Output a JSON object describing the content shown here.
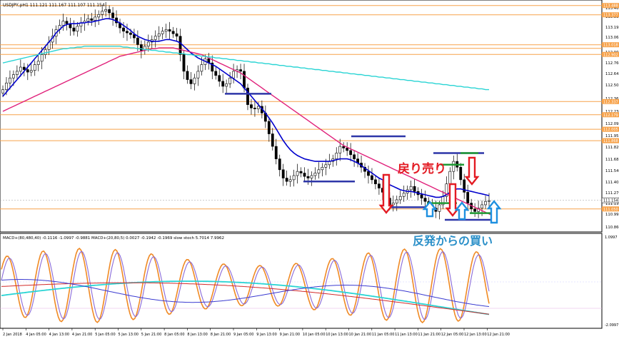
{
  "window": {
    "symbol_line": "USDJPY,pH1  111.121 111.167 111.107 111.154"
  },
  "macd_panel": {
    "info_line": "MACD+(80,480,40) -0.1116 -1.0997 -0.9881  MACD+(20,80,5) 0.0027 -0.1942 -0.1969  slow stoch 5.7014 7.9962",
    "axis_top": "1.0997",
    "axis_bottom": "-2.0997"
  },
  "annotations": {
    "sell_text": "戻り売り",
    "buy_text": "反発からの買い"
  },
  "colors": {
    "ma_fast": "#0000cc",
    "ma_mid": "#e0207a",
    "ma_slow": "#29d4d4",
    "level_line": "#f7a24a",
    "support_line": "#2d36a8",
    "green_line": "#1f9a33",
    "sell_arrow": "#e31b23",
    "buy_arrow": "#1e90e0",
    "sell_text": "#e31b23",
    "buy_text": "#2a8fc8",
    "current_price_tag": "#ffffff"
  },
  "chart_data": [
    {
      "type": "candlestick",
      "title": "USDJPY,pH1",
      "y_ticks": [
        "113.465",
        "113.335",
        "113.195",
        "113.065",
        "112.905",
        "112.760",
        "112.645",
        "112.505",
        "112.365",
        "112.230",
        "112.095",
        "111.955",
        "111.820",
        "111.685",
        "111.540",
        "111.405",
        "111.270",
        "111.135",
        "110.995",
        "110.860"
      ],
      "x_ticks": [
        "2 Jan 2018",
        "4 Jan 05:00",
        "4 Jan 13:00",
        "4 Jan 21:00",
        "5 Jan 05:00",
        "5 Jan 13:00",
        "5 Jan 21:00",
        "8 Jan 05:00",
        "8 Jan 13:00",
        "8 Jan 21:00",
        "9 Jan 05:00",
        "9 Jan 13:00",
        "9 Jan 21:00",
        "10 Jan 05:00",
        "10 Jan 13:00",
        "10 Jan 21:00",
        "11 Jan 05:00",
        "11 Jan 13:00",
        "11 Jan 21:00",
        "12 Jan 05:00",
        "12 Jan 13:00",
        "12 Jan 21:00"
      ],
      "ylim": [
        110.8,
        113.52
      ],
      "price_tags": {
        "current": "111.154",
        "bottom_level": "111.050",
        "tag_1": "113.488",
        "tag_2": "113.377",
        "tag_3": "113.018",
        "tag_4": "112.902",
        "tag_5": "112.337",
        "tag_6": "112.179",
        "tag_7": "112.005",
        "tag_8": "111.868"
      },
      "level_values": [
        113.488,
        113.377,
        113.018,
        112.975,
        112.902,
        112.337,
        112.179,
        112.005,
        111.868,
        111.05
      ],
      "close": [
        112.48,
        112.56,
        112.62,
        112.66,
        112.7,
        112.75,
        112.72,
        112.69,
        112.71,
        112.78,
        112.82,
        112.9,
        112.96,
        113.05,
        113.12,
        113.2,
        113.25,
        113.3,
        113.27,
        113.22,
        113.18,
        113.24,
        113.28,
        113.3,
        113.33,
        113.31,
        113.35,
        113.38,
        113.42,
        113.44,
        113.4,
        113.34,
        113.28,
        113.22,
        113.18,
        113.16,
        113.14,
        113.1,
        113.02,
        112.95,
        113.0,
        113.05,
        113.08,
        113.12,
        113.15,
        113.18,
        113.2,
        113.18,
        113.15,
        113.12,
        112.9,
        112.7,
        112.6,
        112.55,
        112.62,
        112.7,
        112.78,
        112.85,
        112.8,
        112.7,
        112.65,
        112.58,
        112.52,
        112.55,
        112.62,
        112.7,
        112.72,
        112.7,
        112.5,
        112.3,
        112.26,
        112.25,
        112.28,
        112.2,
        112.1,
        111.95,
        111.8,
        111.65,
        111.52,
        111.42,
        111.38,
        111.4,
        111.45,
        111.5,
        111.48,
        111.44,
        111.42,
        111.45,
        111.48,
        111.52,
        111.55,
        111.58,
        111.62,
        111.65,
        111.72,
        111.8,
        111.78,
        111.75,
        111.7,
        111.65,
        111.6,
        111.55,
        111.5,
        111.45,
        111.4,
        111.35,
        111.3,
        111.25,
        111.18,
        111.1,
        111.12,
        111.16,
        111.2,
        111.24,
        111.28,
        111.32,
        111.26,
        111.22,
        111.18,
        111.14,
        111.1,
        111.06,
        111.02,
        111.1,
        111.2,
        111.35,
        111.5,
        111.62,
        111.55,
        111.4,
        111.25,
        111.12,
        111.05,
        111.02,
        111.06,
        111.1,
        111.14,
        111.15
      ],
      "series": [
        {
          "name": "",
          "role": "fast",
          "values": [
            112.4,
            112.45,
            112.5,
            112.55,
            112.6,
            112.65,
            112.7,
            112.75,
            112.8,
            112.85,
            112.9,
            112.95,
            113.0,
            113.05,
            113.1,
            113.16,
            113.2,
            113.24,
            113.26,
            113.27,
            113.27,
            113.27,
            113.28,
            113.28,
            113.29,
            113.29,
            113.3,
            113.31,
            113.32,
            113.33,
            113.33,
            113.32,
            113.3,
            113.28,
            113.25,
            113.22,
            113.19,
            113.15,
            113.12,
            113.1,
            113.08,
            113.07,
            113.06,
            113.06,
            113.06,
            113.07,
            113.08,
            113.08,
            113.07,
            113.06,
            113.04,
            113.0,
            112.96,
            112.92,
            112.89,
            112.86,
            112.84,
            112.82,
            112.8,
            112.78,
            112.76,
            112.73,
            112.7,
            112.67,
            112.64,
            112.61,
            112.58,
            112.55,
            112.5,
            112.45,
            112.4,
            112.35,
            112.3,
            112.25,
            112.2,
            112.14,
            112.08,
            112.01,
            111.94,
            111.87,
            111.81,
            111.76,
            111.72,
            111.69,
            111.67,
            111.65,
            111.64,
            111.63,
            111.62,
            111.62,
            111.62,
            111.62,
            111.62,
            111.63,
            111.64,
            111.65,
            111.65,
            111.65,
            111.64,
            111.62,
            111.6,
            111.57,
            111.54,
            111.51,
            111.48,
            111.45,
            111.42,
            111.4,
            111.37,
            111.34,
            111.32,
            111.3,
            111.28,
            111.27,
            111.26,
            111.26,
            111.25,
            111.24,
            111.23,
            111.22,
            111.21,
            111.2,
            111.19,
            111.19,
            111.2,
            111.22,
            111.25,
            111.28,
            111.29,
            111.29,
            111.28,
            111.27,
            111.26,
            111.25,
            111.24,
            111.23,
            111.22,
            111.21
          ]
        },
        {
          "name": "",
          "role": "mid",
          "values": [
            112.22,
            112.24,
            112.26,
            112.28,
            112.3,
            112.32,
            112.34,
            112.36,
            112.38,
            112.4,
            112.42,
            112.44,
            112.46,
            112.48,
            112.5,
            112.52,
            112.54,
            112.56,
            112.58,
            112.6,
            112.62,
            112.64,
            112.66,
            112.68,
            112.7,
            112.72,
            112.74,
            112.76,
            112.78,
            112.8,
            112.82,
            112.84,
            112.86,
            112.88,
            112.89,
            112.9,
            112.91,
            112.92,
            112.93,
            112.94,
            112.95,
            112.96,
            112.97,
            112.97,
            112.98,
            112.98,
            112.98,
            112.98,
            112.98,
            112.97,
            112.96,
            112.95,
            112.94,
            112.93,
            112.92,
            112.91,
            112.9,
            112.88,
            112.86,
            112.84,
            112.82,
            112.8,
            112.78,
            112.76,
            112.74,
            112.72,
            112.7,
            112.68,
            112.65,
            112.62,
            112.59,
            112.56,
            112.53,
            112.5,
            112.47,
            112.44,
            112.41,
            112.38,
            112.35,
            112.32,
            112.29,
            112.26,
            112.23,
            112.2,
            112.17,
            112.14,
            112.11,
            112.08,
            112.05,
            112.02,
            111.99,
            111.96,
            111.93,
            111.9,
            111.87,
            111.84,
            111.81,
            111.79,
            111.77,
            111.75,
            111.73,
            111.71,
            111.69,
            111.67,
            111.65,
            111.63,
            111.61,
            111.59,
            111.57,
            111.55,
            111.53,
            111.51,
            111.49,
            111.47,
            111.45,
            111.43,
            111.41,
            111.39,
            111.37,
            111.35,
            111.33,
            111.31,
            111.29,
            111.27,
            111.25,
            111.23,
            111.21,
            111.19,
            111.17,
            111.15,
            111.13,
            111.11,
            111.09,
            111.07,
            111.05,
            111.03,
            111.01,
            110.99,
            110.97,
            110.95
          ]
        },
        {
          "name": "",
          "role": "slow",
          "values": [
            112.8,
            112.81,
            112.82,
            112.83,
            112.84,
            112.85,
            112.86,
            112.87,
            112.88,
            112.89,
            112.9,
            112.91,
            112.92,
            112.93,
            112.94,
            112.95,
            112.96,
            112.97,
            112.97,
            112.98,
            112.98,
            112.99,
            112.99,
            113.0,
            113.0,
            113.0,
            113.0,
            113.0,
            113.0,
            113.0,
            113.0,
            113.0,
            113.0,
            113.0,
            112.99,
            112.99,
            112.98,
            112.98,
            112.97,
            112.97,
            112.96,
            112.96,
            112.95,
            112.95,
            112.94,
            112.94,
            112.93,
            112.93,
            112.92,
            112.92,
            112.91,
            112.91,
            112.9,
            112.9,
            112.89,
            112.89,
            112.88,
            112.88,
            112.87,
            112.87,
            112.86,
            112.86,
            112.85,
            112.85,
            112.84,
            112.84,
            112.83,
            112.83,
            112.82,
            112.82,
            112.81,
            112.81,
            112.8,
            112.8,
            112.79,
            112.79,
            112.78,
            112.78,
            112.77,
            112.77,
            112.76,
            112.76,
            112.75,
            112.75,
            112.74,
            112.74,
            112.73,
            112.73,
            112.72,
            112.72,
            112.71,
            112.71,
            112.7,
            112.7,
            112.69,
            112.69,
            112.68,
            112.68,
            112.67,
            112.67,
            112.66,
            112.66,
            112.65,
            112.65,
            112.64,
            112.64,
            112.63,
            112.63,
            112.62,
            112.62,
            112.61,
            112.61,
            112.6,
            112.6,
            112.59,
            112.59,
            112.58,
            112.58,
            112.57,
            112.57,
            112.56,
            112.56,
            112.55,
            112.55,
            112.54,
            112.54,
            112.53,
            112.53,
            112.52,
            112.52,
            112.51,
            112.51,
            112.5,
            112.5,
            112.49,
            112.49,
            112.48,
            112.48
          ]
        }
      ]
    },
    {
      "type": "line",
      "title": "MACD+(80,480,40) / MACD+(20,80,5) / slow stoch",
      "ylim": [
        -2.2,
        1.2
      ],
      "note": "oscillator panel"
    }
  ]
}
